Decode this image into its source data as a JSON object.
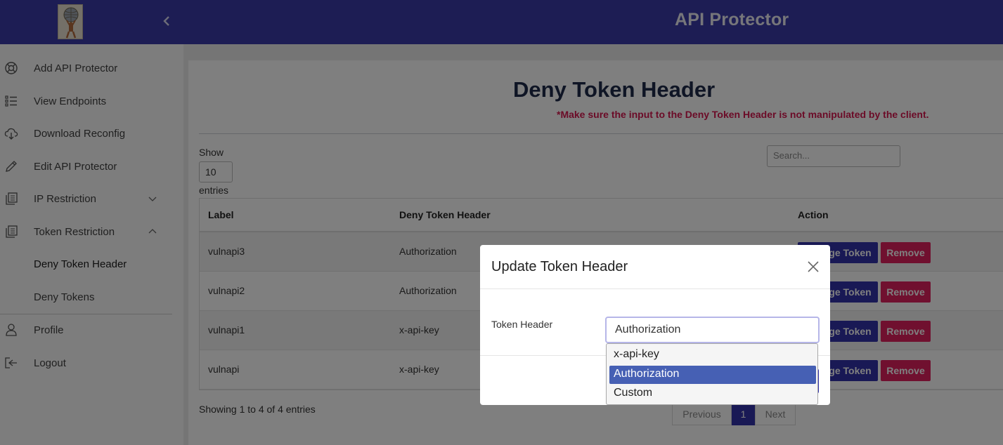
{
  "app": {
    "title": "API Protector"
  },
  "sidebar": {
    "items": [
      {
        "label": "Add API Protector"
      },
      {
        "label": "View Endpoints"
      },
      {
        "label": "Download Reconfig"
      },
      {
        "label": "Edit API Protector"
      },
      {
        "label": "IP Restriction"
      },
      {
        "label": "Token Restriction"
      },
      {
        "label": "Deny Token Header"
      },
      {
        "label": "Deny Tokens"
      },
      {
        "label": "Profile"
      },
      {
        "label": "Logout"
      }
    ]
  },
  "page": {
    "heading": "Deny Token Header",
    "warning": "*Make sure the input to the Deny Token Header is not manipulated by the client.",
    "show_label": "Show",
    "length_value": "10",
    "entries_label": "entries",
    "search_placeholder": "Search..."
  },
  "table": {
    "columns": [
      "Label",
      "Deny Token Header",
      "Action"
    ],
    "rows": [
      {
        "label": "vulnapi3",
        "header": "Authorization"
      },
      {
        "label": "vulnapi2",
        "header": "Authorization"
      },
      {
        "label": "vulnapi1",
        "header": "x-api-key"
      },
      {
        "label": "vulnapi",
        "header": "x-api-key"
      }
    ],
    "change_label": "Change Token",
    "remove_label": "Remove",
    "info": "Showing 1 to 4 of 4 entries",
    "pager": {
      "prev": "Previous",
      "current": "1",
      "next": "Next"
    }
  },
  "modal": {
    "title": "Update Token Header",
    "field_label": "Token Header",
    "selected_value": "Authorization",
    "options": [
      "x-api-key",
      "Authorization",
      "Custom"
    ]
  },
  "colors": {
    "topbar": "#3a3aa8",
    "primary": "#3333aa",
    "danger": "#e0215e",
    "warning_text": "#d6174f",
    "dropdown_highlight": "#4660b4"
  }
}
